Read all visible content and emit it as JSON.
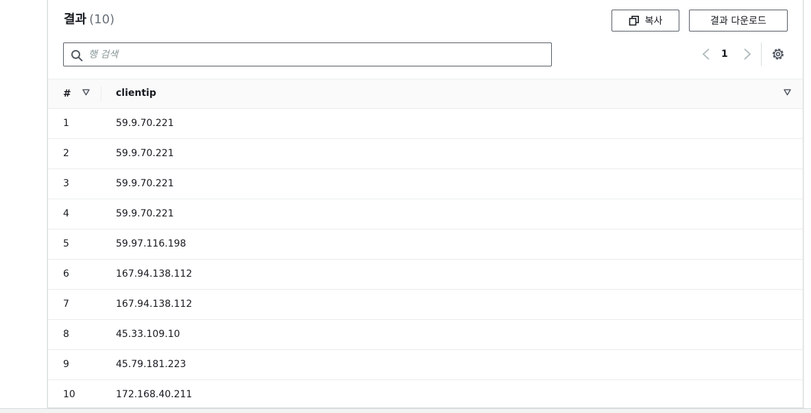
{
  "results": {
    "title": "결과",
    "count": "(10)",
    "copy_label": "복사",
    "download_label": "결과 다운로드"
  },
  "search": {
    "placeholder": "행 검색",
    "value": ""
  },
  "pagination": {
    "current_page": "1"
  },
  "table": {
    "columns": [
      "#",
      "clientip"
    ],
    "rows": [
      {
        "num": "1",
        "clientip": "59.9.70.221"
      },
      {
        "num": "2",
        "clientip": "59.9.70.221"
      },
      {
        "num": "3",
        "clientip": "59.9.70.221"
      },
      {
        "num": "4",
        "clientip": "59.9.70.221"
      },
      {
        "num": "5",
        "clientip": "59.97.116.198"
      },
      {
        "num": "6",
        "clientip": "167.94.138.112"
      },
      {
        "num": "7",
        "clientip": "167.94.138.112"
      },
      {
        "num": "8",
        "clientip": "45.33.109.10"
      },
      {
        "num": "9",
        "clientip": "45.79.181.223"
      },
      {
        "num": "10",
        "clientip": "172.168.40.211"
      }
    ]
  },
  "icons": {
    "copy": "copy-icon",
    "search": "search-icon",
    "prev": "chevron-left-icon",
    "next": "chevron-right-icon",
    "settings": "gear-icon",
    "sort": "sort-triangle-icon"
  },
  "colors": {
    "text": "#16191f",
    "muted": "#687078",
    "border": "#545b64",
    "divider": "#eaeded"
  }
}
